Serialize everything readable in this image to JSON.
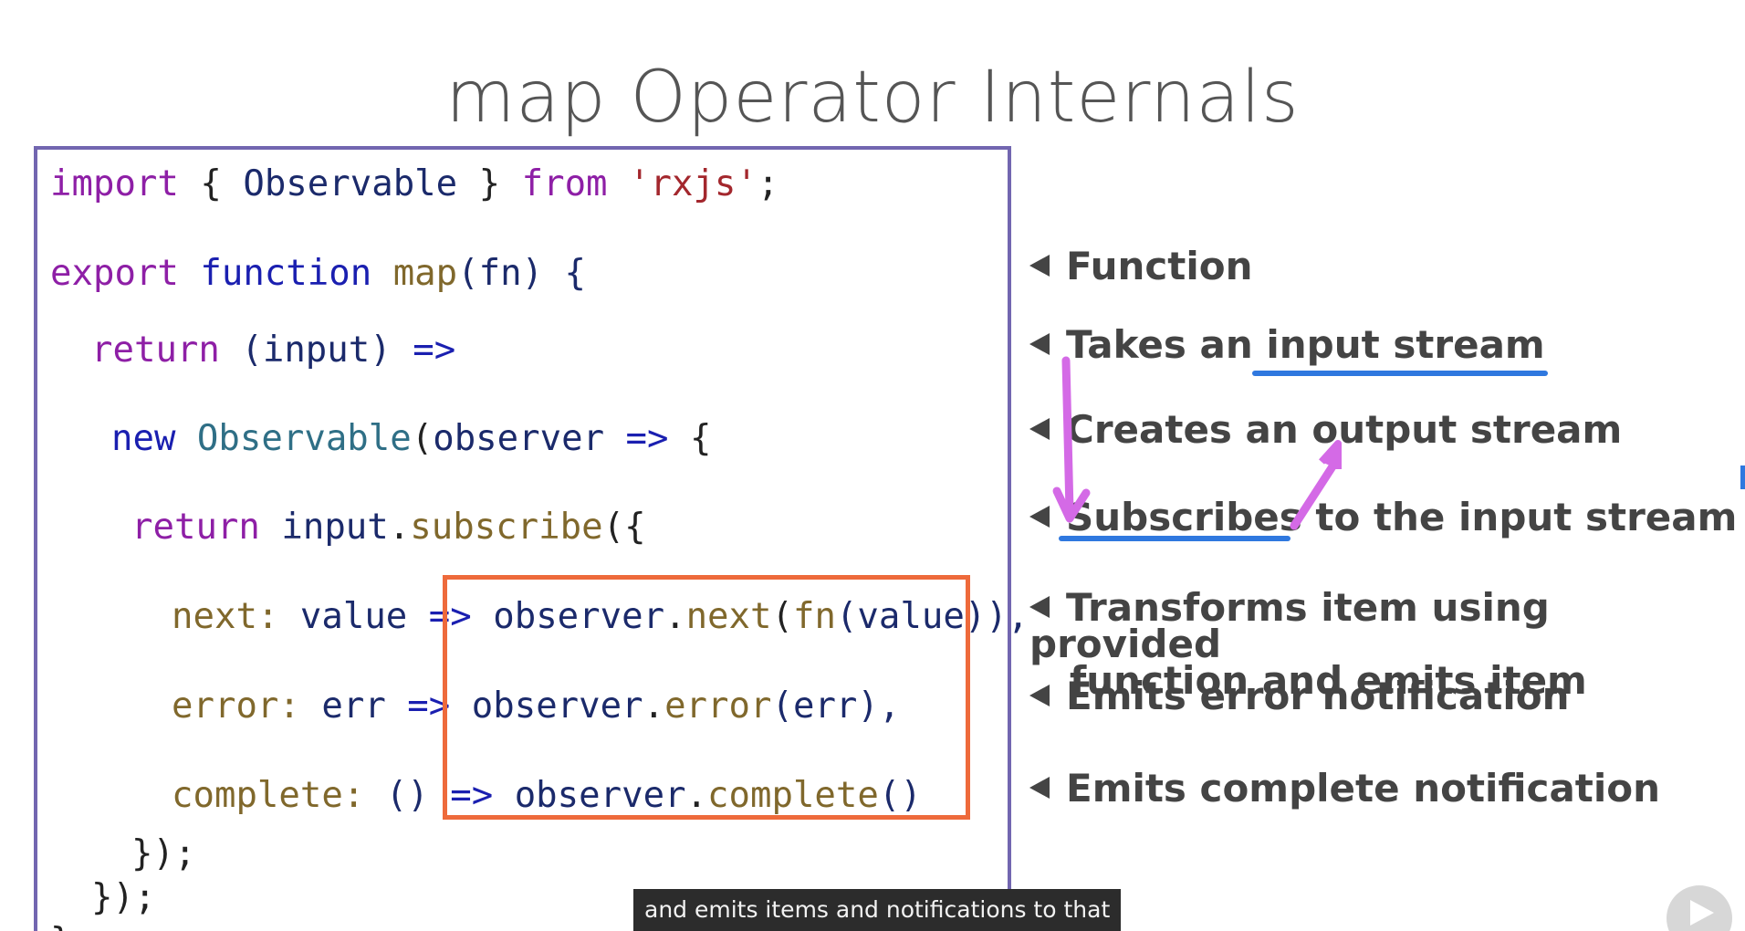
{
  "slide": {
    "title": "map Operator Internals"
  },
  "code": {
    "l1": {
      "kw_import": "import",
      "brace_open": " { ",
      "type": "Observable",
      "brace_close": " } ",
      "kw_from": "from",
      "str": " 'rxjs'",
      "semi": ";"
    },
    "l2": {
      "kw_export": "export",
      "kw_function": " function ",
      "fn_name": "map",
      "params": "(fn) {"
    },
    "l3": {
      "kw_return": "return",
      "rest": " (input) ",
      "arrow": "=>"
    },
    "l4": {
      "kw_new": "new",
      "type": " Observable",
      "paren": "(",
      "id": "observer",
      "arrow": " => ",
      "brace": "{"
    },
    "l5": {
      "kw_return": "return",
      "id": " input",
      "dot": ".",
      "fn": "subscribe",
      "rest": "({"
    },
    "l6": {
      "prop": "next:",
      "id": " value ",
      "arrow": "=> ",
      "obj": "observer",
      "dot": ".",
      "fn": "next",
      "p1": "(",
      "fn2": "fn",
      "p2": "(value)),"
    },
    "l7": {
      "prop": "error:",
      "id": " err ",
      "arrow": "=> ",
      "obj": "observer",
      "dot": ".",
      "fn": "error",
      "rest": "(err),"
    },
    "l8": {
      "prop": "complete:",
      "id": " () ",
      "arrow": "=> ",
      "obj": "observer",
      "dot": ".",
      "fn": "complete",
      "rest": "()"
    },
    "l9": "});",
    "l10": "});",
    "l11": "}"
  },
  "annotations": {
    "a1": "Function",
    "a2": "Takes an input stream",
    "a3": "Creates an output stream",
    "a4": "Subscribes to the input stream",
    "a5_line1": "Transforms item using provided",
    "a5_line2": "function and emits item",
    "a6": "Emits error notification",
    "a7": "Emits complete notification"
  },
  "caption": {
    "text": "and emits items and notifications to that"
  },
  "colors": {
    "code_box_border": "#7266b0",
    "highlight_border": "#ee6a3b",
    "pen_stroke": "#d46ae6",
    "underline": "#2f78df"
  },
  "icons": {
    "annotation_pointer": "left-triangle-icon",
    "player_logo": "play-logo-icon"
  }
}
